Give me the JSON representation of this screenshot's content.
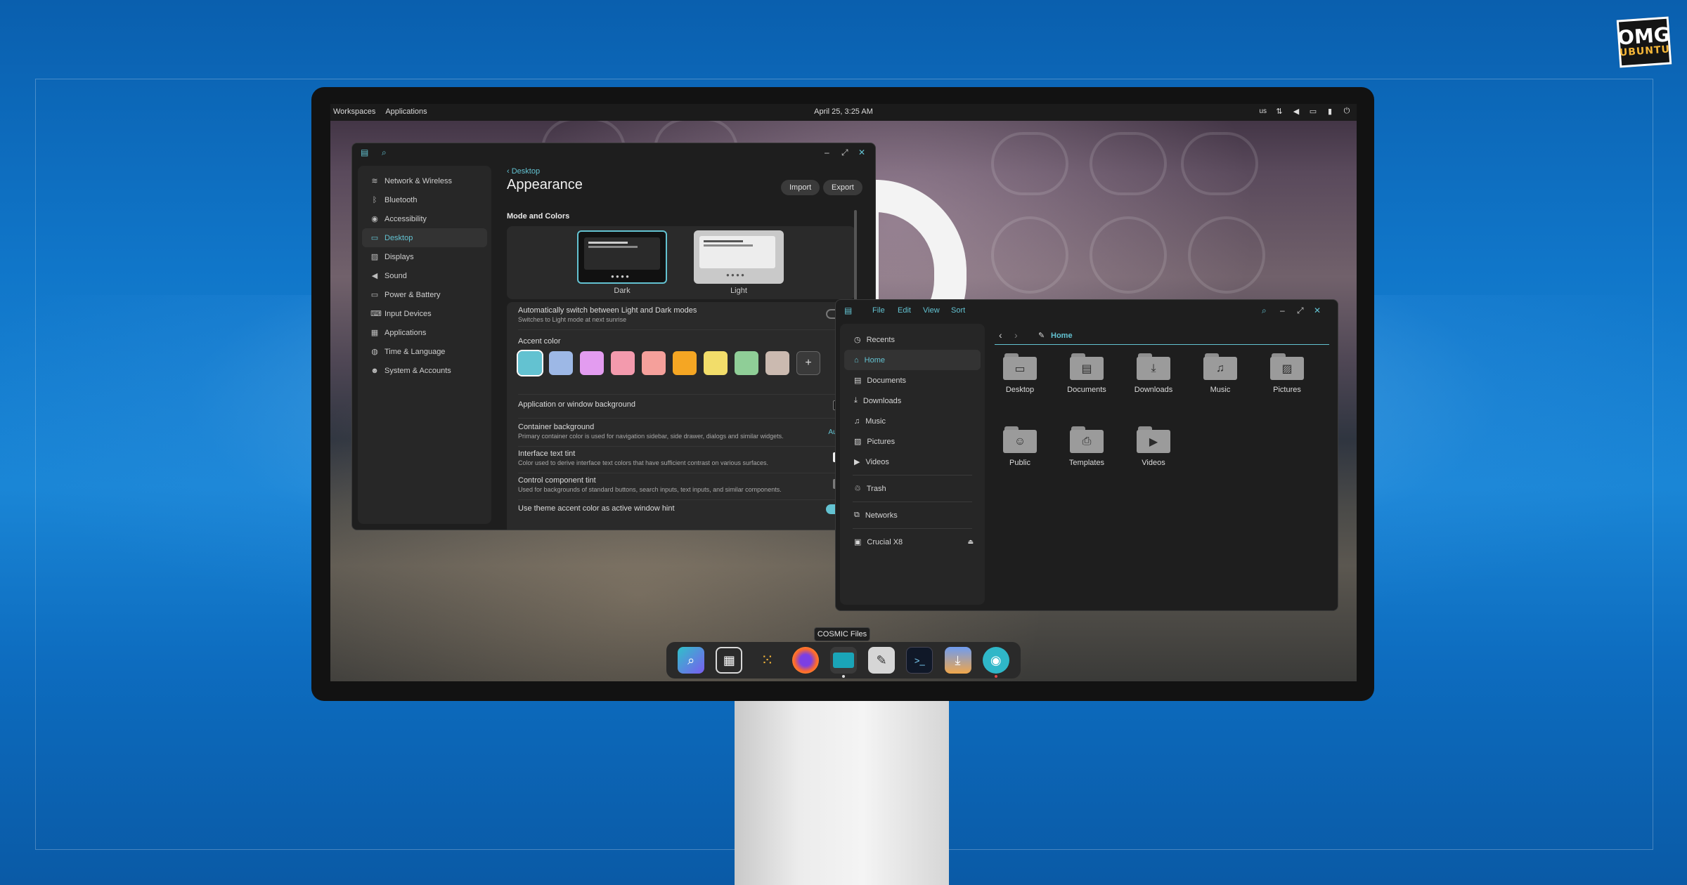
{
  "brand": {
    "line1": "OMG",
    "line2": "UBUNTU"
  },
  "colors": {
    "accent": "#63c2d1"
  },
  "panel": {
    "workspaces": "Workspaces",
    "applications": "Applications",
    "datetime": "April 25, 3:25 AM",
    "keyboard": "us",
    "tray_icons": [
      "network-icon",
      "sound-icon",
      "notifications-icon",
      "battery-icon",
      "power-icon"
    ]
  },
  "settings": {
    "sidebar": [
      {
        "label": "Network & Wireless",
        "icon": "wifi-icon"
      },
      {
        "label": "Bluetooth",
        "icon": "bluetooth-icon"
      },
      {
        "label": "Accessibility",
        "icon": "accessibility-icon"
      },
      {
        "label": "Desktop",
        "icon": "desktop-icon",
        "active": true
      },
      {
        "label": "Displays",
        "icon": "display-icon"
      },
      {
        "label": "Sound",
        "icon": "sound-icon"
      },
      {
        "label": "Power & Battery",
        "icon": "battery-icon"
      },
      {
        "label": "Input Devices",
        "icon": "keyboard-icon"
      },
      {
        "label": "Applications",
        "icon": "apps-icon"
      },
      {
        "label": "Time & Language",
        "icon": "globe-icon"
      },
      {
        "label": "System & Accounts",
        "icon": "users-icon"
      }
    ],
    "breadcrumb": "Desktop",
    "title": "Appearance",
    "import_label": "Import",
    "export_label": "Export",
    "section": "Mode and Colors",
    "dark_label": "Dark",
    "light_label": "Light",
    "auto_switch": {
      "title": "Automatically switch between Light and Dark modes",
      "subtitle": "Switches to Light mode at next sunrise",
      "on": false
    },
    "accent_title": "Accent color",
    "accent_colors": [
      "#63c2d1",
      "#9db8e6",
      "#e39cf0",
      "#f39aad",
      "#f5a09b",
      "#f5a623",
      "#f2dd6a",
      "#8fce97",
      "#cbbab0"
    ],
    "add_color": "+",
    "window_bg": {
      "title": "Application or window background"
    },
    "container_bg": {
      "title": "Container background",
      "subtitle": "Primary container color is used for navigation sidebar, side drawer, dialogs and similar widgets.",
      "value": "Auto"
    },
    "text_tint": {
      "title": "Interface text tint",
      "subtitle": "Color used to derive interface text colors that have sufficient contrast on various surfaces."
    },
    "control_tint": {
      "title": "Control component tint",
      "subtitle": "Used for backgrounds of standard buttons, search inputs, text inputs, and similar components."
    },
    "accent_hint": {
      "title": "Use theme accent color as active window hint",
      "on": true
    }
  },
  "files": {
    "menu": [
      "File",
      "Edit",
      "View",
      "Sort"
    ],
    "sidebar": [
      {
        "label": "Recents",
        "icon": "clock-icon"
      },
      {
        "label": "Home",
        "icon": "home-icon",
        "active": true
      },
      {
        "label": "Documents",
        "icon": "document-icon"
      },
      {
        "label": "Downloads",
        "icon": "download-icon"
      },
      {
        "label": "Music",
        "icon": "music-icon"
      },
      {
        "label": "Pictures",
        "icon": "image-icon"
      },
      {
        "label": "Videos",
        "icon": "video-icon"
      }
    ],
    "trash": "Trash",
    "networks": "Networks",
    "drive": "Crucial X8",
    "path": "Home",
    "items": [
      {
        "label": "Desktop",
        "glyph": "▭"
      },
      {
        "label": "Documents",
        "glyph": "▤"
      },
      {
        "label": "Downloads",
        "glyph": "⤓"
      },
      {
        "label": "Music",
        "glyph": "♫"
      },
      {
        "label": "Pictures",
        "glyph": "▨"
      },
      {
        "label": "Public",
        "glyph": "☺"
      },
      {
        "label": "Templates",
        "glyph": "⎙"
      },
      {
        "label": "Videos",
        "glyph": "▶"
      }
    ]
  },
  "dock": {
    "tooltip": "COSMIC Files",
    "apps": [
      "launcher",
      "workspaces",
      "app-grid",
      "firefox",
      "files",
      "text-editor",
      "terminal",
      "store",
      "settings"
    ]
  }
}
